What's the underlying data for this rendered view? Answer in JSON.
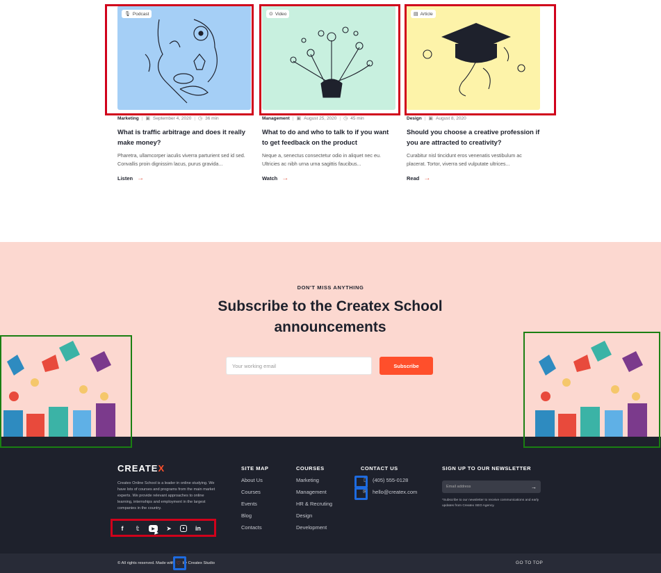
{
  "cards": [
    {
      "badge": "Podcast",
      "badge_icon": "mic-icon",
      "bg": "#a5cff6",
      "category": "Marketing",
      "date": "September 4, 2020",
      "duration": "36 min",
      "title": "What is traffic arbitrage and does it really make money?",
      "excerpt": "Pharetra, ullamcorper iaculis viverra parturient sed id sed. Convallis proin dignissim lacus, purus gravida...",
      "action": "Listen"
    },
    {
      "badge": "Video",
      "badge_icon": "play-icon",
      "bg": "#c8f0df",
      "category": "Management",
      "date": "August 25, 2020",
      "duration": "45 min",
      "title": "What to do and who to talk to if you want to get feedback on the product",
      "excerpt": "Neque a, senectus consectetur odio in aliquet nec eu. Ultricies ac nibh urna urna sagittis faucibus...",
      "action": "Watch"
    },
    {
      "badge": "Article",
      "badge_icon": "file-icon",
      "bg": "#fdf3a9",
      "category": "Design",
      "date": "August 8, 2020",
      "duration": "",
      "title": "Should you choose a creative profession if you are attracted to creativity?",
      "excerpt": "Curabitur nisl tincidunt eros venenatis vestibulum ac placerat. Tortor, viverra sed vulputate ultrices...",
      "action": "Read"
    }
  ],
  "subscribe": {
    "eyebrow": "DON'T MISS ANYTHING",
    "title": "Subscribe to the Createx School announcements",
    "placeholder": "Your working email",
    "button": "Subscribe",
    "bg": "#fcd8d0",
    "accent": "#ff4f2b"
  },
  "footer": {
    "logo_main": "CREATE",
    "logo_accent": "X",
    "about": "Createx Online School is a leader in online studying. We have lots of courses and programs from the main market experts. We provide relevant approaches to online learning, internships and employment in the largest companies in the country.",
    "socials": [
      "facebook-icon",
      "twitter-icon",
      "youtube-icon",
      "telegram-icon",
      "instagram-icon",
      "linkedin-icon"
    ],
    "sitemap": {
      "title": "SITE MAP",
      "items": [
        "About Us",
        "Courses",
        "Events",
        "Blog",
        "Contacts"
      ]
    },
    "courses": {
      "title": "COURSES",
      "items": [
        "Marketing",
        "Management",
        "HR & Recruting",
        "Design",
        "Development"
      ]
    },
    "contact": {
      "title": "CONTACT US",
      "phone": "(405) 555-0128",
      "email": "hello@createx.com"
    },
    "newsletter": {
      "title": "SIGN UP TO OUR NEWSLETTER",
      "placeholder": "Email address",
      "note": "*Subscribe to our newsletter to receive communications and early updates from Createx SEO Agency."
    },
    "copyright_pre": "© All rights reserved. Made with",
    "copyright_post": "by Createx Studio",
    "go_top": "GO TO TOP",
    "bg": "#1e212c"
  }
}
